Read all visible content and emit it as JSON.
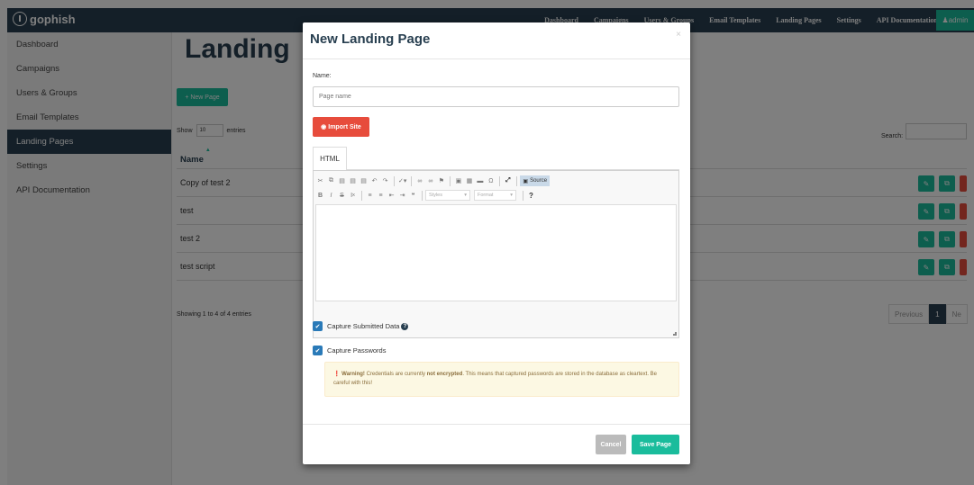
{
  "navbar": {
    "brand": "gophish",
    "links": [
      "Dashboard",
      "Campaigns",
      "Users & Groups",
      "Email Templates",
      "Landing Pages",
      "Settings",
      "API Documentation"
    ],
    "admin_label": "admin"
  },
  "sidebar": {
    "items": [
      {
        "label": "Dashboard"
      },
      {
        "label": "Campaigns"
      },
      {
        "label": "Users & Groups"
      },
      {
        "label": "Email Templates"
      },
      {
        "label": "Landing Pages",
        "active": true
      },
      {
        "label": "Settings"
      },
      {
        "label": "API Documentation"
      }
    ]
  },
  "main": {
    "title": "Landing",
    "new_button": "+ New Page",
    "show_label": "Show",
    "show_value": "10",
    "entries_label": "entries",
    "search_label": "Search:",
    "table": {
      "header_name": "Name",
      "rows": [
        "Copy of test 2",
        "test",
        "test 2",
        "test script"
      ]
    },
    "showing": "Showing 1 to 4 of 4 entries",
    "pager": {
      "previous": "Previous",
      "current": "1",
      "next": "Ne"
    }
  },
  "modal": {
    "title": "New Landing Page",
    "close": "×",
    "name_label": "Name:",
    "name_placeholder": "Page name",
    "import_button": "Import Site",
    "tab_html": "HTML",
    "toolbar": {
      "source_label": "Source",
      "styles_label": "Styles",
      "format_label": "Format"
    },
    "capture_submitted_label": "Capture Submitted Data",
    "capture_passwords_label": "Capture Passwords",
    "warning": {
      "strong": "Warning!",
      "text1": " Credentials are currently ",
      "strong2": "not encrypted",
      "text2": ". This means that captured passwords are stored in the database as cleartext. Be careful with this!"
    },
    "cancel_button": "Cancel",
    "save_button": "Save Page"
  },
  "colors": {
    "navbar": "#283f50",
    "primary_green": "#1abc9c",
    "danger_red": "#e74c3c",
    "checkbox_blue": "#2a7ab8"
  }
}
